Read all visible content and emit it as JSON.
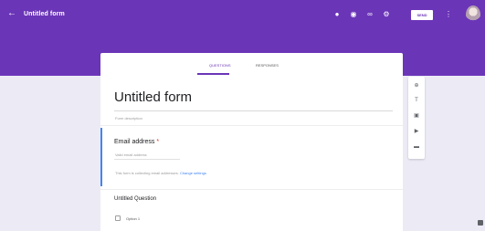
{
  "topbar": {
    "back_icon": "arrow-left-icon",
    "title": "Untitled form",
    "icons": [
      "palette-icon",
      "eye-icon",
      "link-icon",
      "gear-icon"
    ],
    "send_label": "SEND",
    "more_icon": "more-vert-icon"
  },
  "tabs": [
    {
      "label": "QUESTIONS",
      "active": true
    },
    {
      "label": "RESPONSES",
      "active": false
    }
  ],
  "form": {
    "title": "Untitled form",
    "description_placeholder": "Form description"
  },
  "questions": [
    {
      "label": "Email address",
      "required_marker": "*",
      "answer_placeholder": "Valid email address",
      "note": "This form is collecting email addresses.",
      "note_link": "Change settings"
    },
    {
      "label": "Untitled Question",
      "option_label": "Option 1"
    }
  ],
  "sidebar_tools": [
    "add-circle-icon",
    "text-icon",
    "image-icon",
    "video-icon",
    "section-icon"
  ],
  "colors": {
    "accent": "#6b35b8",
    "background": "#ecebf5",
    "active_bar": "#4285f4",
    "required": "#d93025"
  }
}
